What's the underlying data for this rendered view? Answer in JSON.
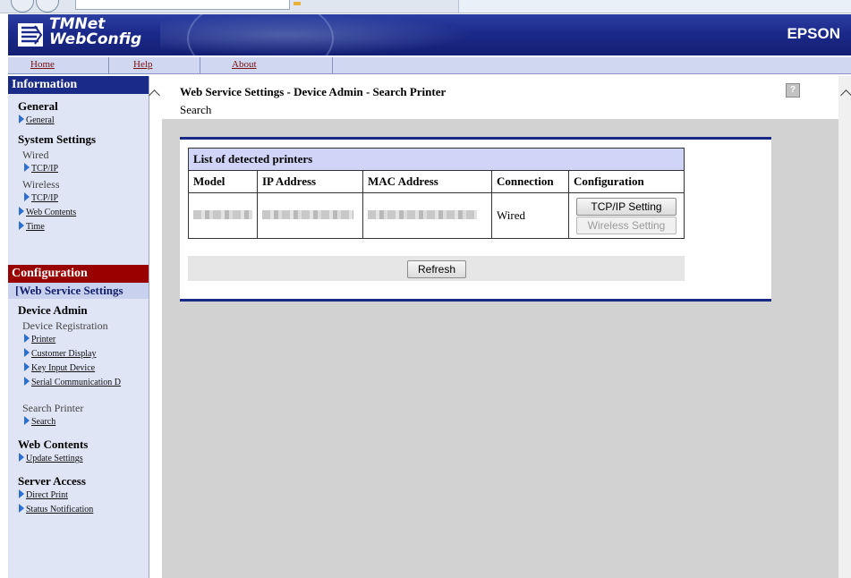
{
  "header": {
    "logo_line1": "TMNet",
    "logo_line2": "WebConfig",
    "brand": "EPSON"
  },
  "topnav": {
    "home": "Home",
    "help": "Help",
    "about": "About"
  },
  "sidebar": {
    "information": {
      "title": "Information",
      "general_group": "General",
      "general_link": "General",
      "system_group": "System Settings",
      "wired": "Wired",
      "wired_tcpip": "TCP/IP",
      "wireless": "Wireless",
      "wireless_tcpip": "TCP/IP",
      "web_contents": "Web Contents",
      "time": "Time"
    },
    "configuration": {
      "title": "Configuration",
      "selected": "[Web Service Settings",
      "device_admin": "Device Admin",
      "device_registration": "Device Registration",
      "printer": "Printer",
      "customer_display": "Customer Display",
      "key_input": "Key Input Device",
      "serial": "Serial Communication D",
      "search_printer": "Search Printer",
      "search": "Search",
      "web_contents_group": "Web Contents",
      "update_settings": "Update Settings",
      "server_access": "Server Access",
      "direct_print": "Direct Print",
      "status_notification": "Status Notification"
    }
  },
  "main": {
    "title": "Web Service Settings - Device Admin - Search Printer",
    "subtitle": "Search",
    "help_icon": "?",
    "table": {
      "caption": "List of detected printers",
      "headers": [
        "Model",
        "IP Address",
        "MAC Address",
        "Connection",
        "Configuration"
      ],
      "row": {
        "connection": "Wired",
        "tcpip_button": "TCP/IP Setting",
        "wireless_button": "Wireless Setting"
      }
    },
    "refresh_button": "Refresh"
  },
  "colors": {
    "banner": "#1b2a8a",
    "info_header": "#1a2a87",
    "config_header": "#990000",
    "sidebar_bg": "#dfe5f5",
    "content_bg": "#d2d2d2",
    "nav_link": "#7a1010"
  }
}
